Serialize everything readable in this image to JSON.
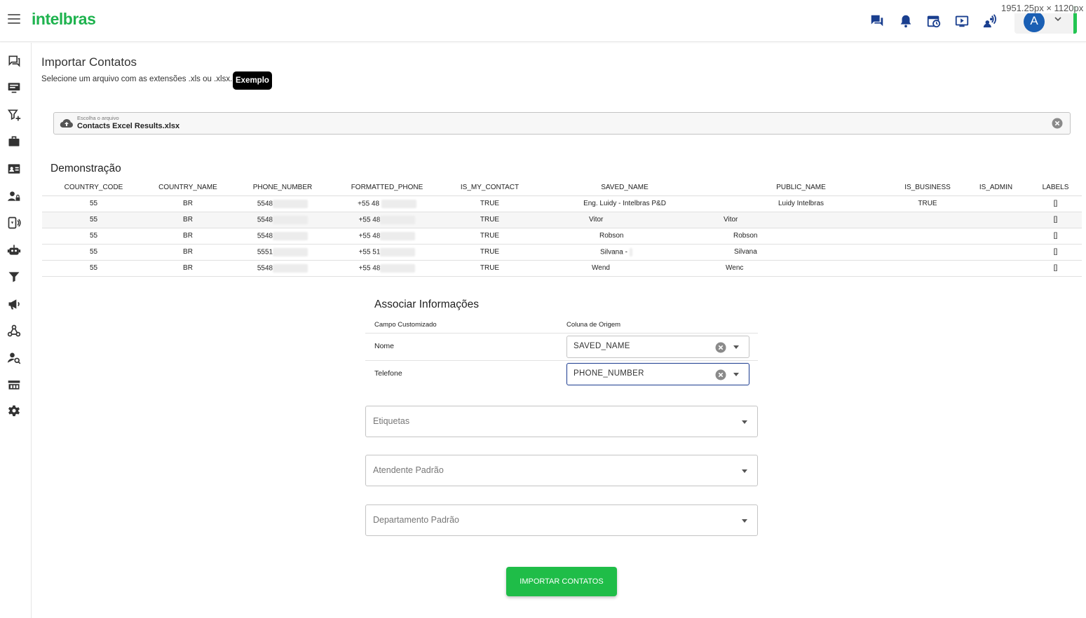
{
  "header": {
    "logo_text": "intelbras",
    "viewport_label": "1951.25px × 1120px",
    "user_initial": "A",
    "icons": [
      "chat-icon",
      "bell-icon",
      "calendar-clock-icon",
      "video-icon",
      "broadcast-users-icon"
    ],
    "accent_color": "#1fb34f"
  },
  "sidebar": {
    "items": [
      "chat-icon",
      "monitor-icon",
      "filter-add-icon",
      "briefcase-icon",
      "contact-card-icon",
      "user-lock-icon",
      "device-connect-icon",
      "robot-icon",
      "funnel-icon",
      "megaphone-icon",
      "webhook-icon",
      "user-search-icon",
      "store-icon",
      "gear-icon"
    ]
  },
  "page": {
    "title": "Importar Contatos",
    "subtitle": "Selecione um arquivo com as extensões .xls ou .xlsx.",
    "example_label": "Exemplo"
  },
  "file": {
    "label": "Escolha o arquivo",
    "name": "Contacts Excel Results.xlsx"
  },
  "demo": {
    "title": "Demonstração",
    "columns": [
      "COUNTRY_CODE",
      "COUNTRY_NAME",
      "PHONE_NUMBER",
      "FORMATTED_PHONE",
      "IS_MY_CONTACT",
      "SAVED_NAME",
      "PUBLIC_NAME",
      "IS_BUSINESS",
      "IS_ADMIN",
      "LABELS"
    ],
    "rows": [
      {
        "country_code": "55",
        "country_name": "BR",
        "phone": "5548",
        "formatted": "+55 48",
        "is_my_contact": "TRUE",
        "saved_name": "Eng. Luidy - Intelbras P&D",
        "public_name": "Luidy Intelbras",
        "is_business": "TRUE",
        "is_admin": "",
        "labels": "[]"
      },
      {
        "country_code": "55",
        "country_name": "BR",
        "phone": "5548",
        "formatted": "+55 48",
        "is_my_contact": "TRUE",
        "saved_name": "Vitor",
        "public_name": "Vitor",
        "is_business": "",
        "is_admin": "",
        "labels": "[]"
      },
      {
        "country_code": "55",
        "country_name": "BR",
        "phone": "5548",
        "formatted": "+55 48",
        "is_my_contact": "TRUE",
        "saved_name": "Robson",
        "public_name": "Robson",
        "is_business": "",
        "is_admin": "",
        "labels": "[]"
      },
      {
        "country_code": "55",
        "country_name": "BR",
        "phone": "5551",
        "formatted": "+55 51",
        "is_my_contact": "TRUE",
        "saved_name": "Silvana -",
        "public_name": "Silvana",
        "is_business": "",
        "is_admin": "",
        "labels": "[]"
      },
      {
        "country_code": "55",
        "country_name": "BR",
        "phone": "5548",
        "formatted": "+55 48",
        "is_my_contact": "TRUE",
        "saved_name": "Wend",
        "public_name": "Wenc",
        "is_business": "",
        "is_admin": "",
        "labels": "[]"
      }
    ]
  },
  "assoc": {
    "title": "Associar Informações",
    "col_custom": "Campo Customizado",
    "col_origin": "Coluna de Origem",
    "rows": [
      {
        "label": "Nome",
        "value": "SAVED_NAME"
      },
      {
        "label": "Telefone",
        "value": "PHONE_NUMBER"
      }
    ]
  },
  "selects": {
    "tags": "Etiquetas",
    "agent": "Atendente Padrão",
    "department": "Departamento Padrão"
  },
  "import_label": "IMPORTAR CONTATOS"
}
